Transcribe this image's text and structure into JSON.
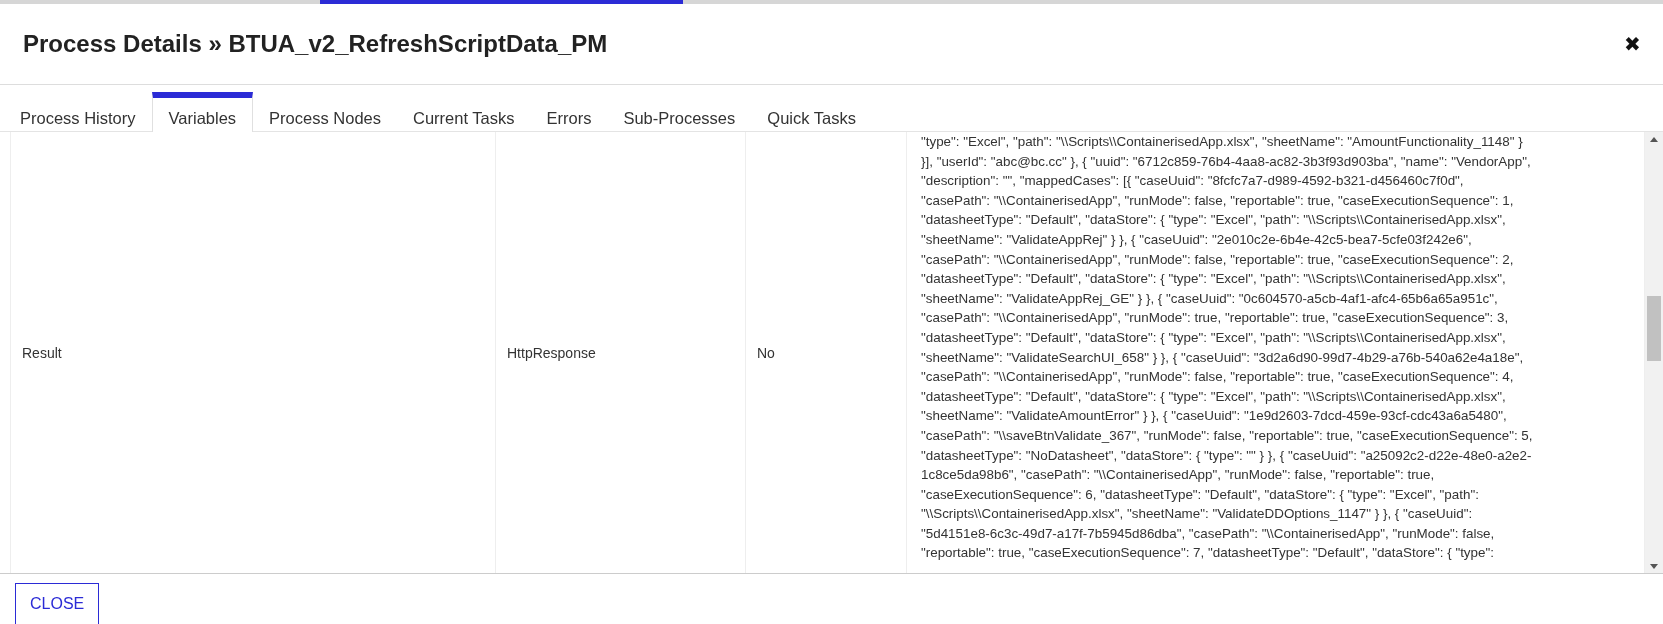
{
  "dialog": {
    "title": "Process Details » BTUA_v2_RefreshScriptData_PM",
    "close_icon": "✖"
  },
  "tabs": [
    {
      "label": "Process History",
      "selected": false
    },
    {
      "label": "Variables",
      "selected": true
    },
    {
      "label": "Process Nodes",
      "selected": false
    },
    {
      "label": "Current Tasks",
      "selected": false
    },
    {
      "label": "Errors",
      "selected": false
    },
    {
      "label": "Sub-Processes",
      "selected": false
    },
    {
      "label": "Quick Tasks",
      "selected": false
    }
  ],
  "table": {
    "rows": [
      {
        "name": "Result",
        "type": "HttpResponse",
        "column_3": "No",
        "value_lines": [
          "\"type\": \"Excel\", \"path\": \"\\\\Scripts\\\\ContainerisedApp.xlsx\", \"sheetName\": \"AmountFunctionality_1148\" }",
          "}], \"userId\": \"abc@bc.cc\" }, { \"uuid\": \"6712c859-76b4-4aa8-ac82-3b3f93d903ba\", \"name\": \"VendorApp\",",
          "\"description\": \"\", \"mappedCases\": [{ \"caseUuid\": \"8fcfc7a7-d989-4592-b321-d456460c7f0d\",",
          "\"casePath\": \"\\\\ContainerisedApp\", \"runMode\": false, \"reportable\": true, \"caseExecutionSequence\": 1,",
          "\"datasheetType\": \"Default\", \"dataStore\": { \"type\": \"Excel\", \"path\": \"\\\\Scripts\\\\ContainerisedApp.xlsx\",",
          "\"sheetName\": \"ValidateAppRej\" } }, { \"caseUuid\": \"2e010c2e-6b4e-42c5-bea7-5cfe03f242e6\",",
          "\"casePath\": \"\\\\ContainerisedApp\", \"runMode\": false, \"reportable\": true, \"caseExecutionSequence\": 2,",
          "\"datasheetType\": \"Default\", \"dataStore\": { \"type\": \"Excel\", \"path\": \"\\\\Scripts\\\\ContainerisedApp.xlsx\",",
          "\"sheetName\": \"ValidateAppRej_GE\" } }, { \"caseUuid\": \"0c604570-a5cb-4af1-afc4-65b6a65a951c\",",
          "\"casePath\": \"\\\\ContainerisedApp\", \"runMode\": true, \"reportable\": true, \"caseExecutionSequence\": 3,",
          "\"datasheetType\": \"Default\", \"dataStore\": { \"type\": \"Excel\", \"path\": \"\\\\Scripts\\\\ContainerisedApp.xlsx\",",
          "\"sheetName\": \"ValidateSearchUI_658\" } }, { \"caseUuid\": \"3d2a6d90-99d7-4b29-a76b-540a62e4a18e\",",
          "\"casePath\": \"\\\\ContainerisedApp\", \"runMode\": false, \"reportable\": true, \"caseExecutionSequence\": 4,",
          "\"datasheetType\": \"Default\", \"dataStore\": { \"type\": \"Excel\", \"path\": \"\\\\Scripts\\\\ContainerisedApp.xlsx\",",
          "\"sheetName\": \"ValidateAmountError\" } }, { \"caseUuid\": \"1e9d2603-7dcd-459e-93cf-cdc43a6a5480\",",
          "\"casePath\": \"\\\\saveBtnValidate_367\", \"runMode\": false, \"reportable\": true, \"caseExecutionSequence\": 5,",
          "\"datasheetType\": \"NoDatasheet\", \"dataStore\": { \"type\": \"\" } }, { \"caseUuid\": \"a25092c2-d22e-48e0-a2e2-",
          "1c8ce5da98b6\", \"casePath\": \"\\\\ContainerisedApp\", \"runMode\": false, \"reportable\": true,",
          "\"caseExecutionSequence\": 6, \"datasheetType\": \"Default\", \"dataStore\": { \"type\": \"Excel\", \"path\":",
          "\"\\\\Scripts\\\\ContainerisedApp.xlsx\", \"sheetName\": \"ValidateDDOptions_1147\" } }, { \"caseUuid\":",
          "\"5d4151e8-6c3c-49d7-a17f-7b5945d86dba\", \"casePath\": \"\\\\ContainerisedApp\", \"runMode\": false,",
          "\"reportable\": true, \"caseExecutionSequence\": 7, \"datasheetType\": \"Default\", \"dataStore\": { \"type\":"
        ]
      }
    ]
  },
  "footer": {
    "close_button": "CLOSE"
  },
  "progress": {
    "level": 0.27
  }
}
